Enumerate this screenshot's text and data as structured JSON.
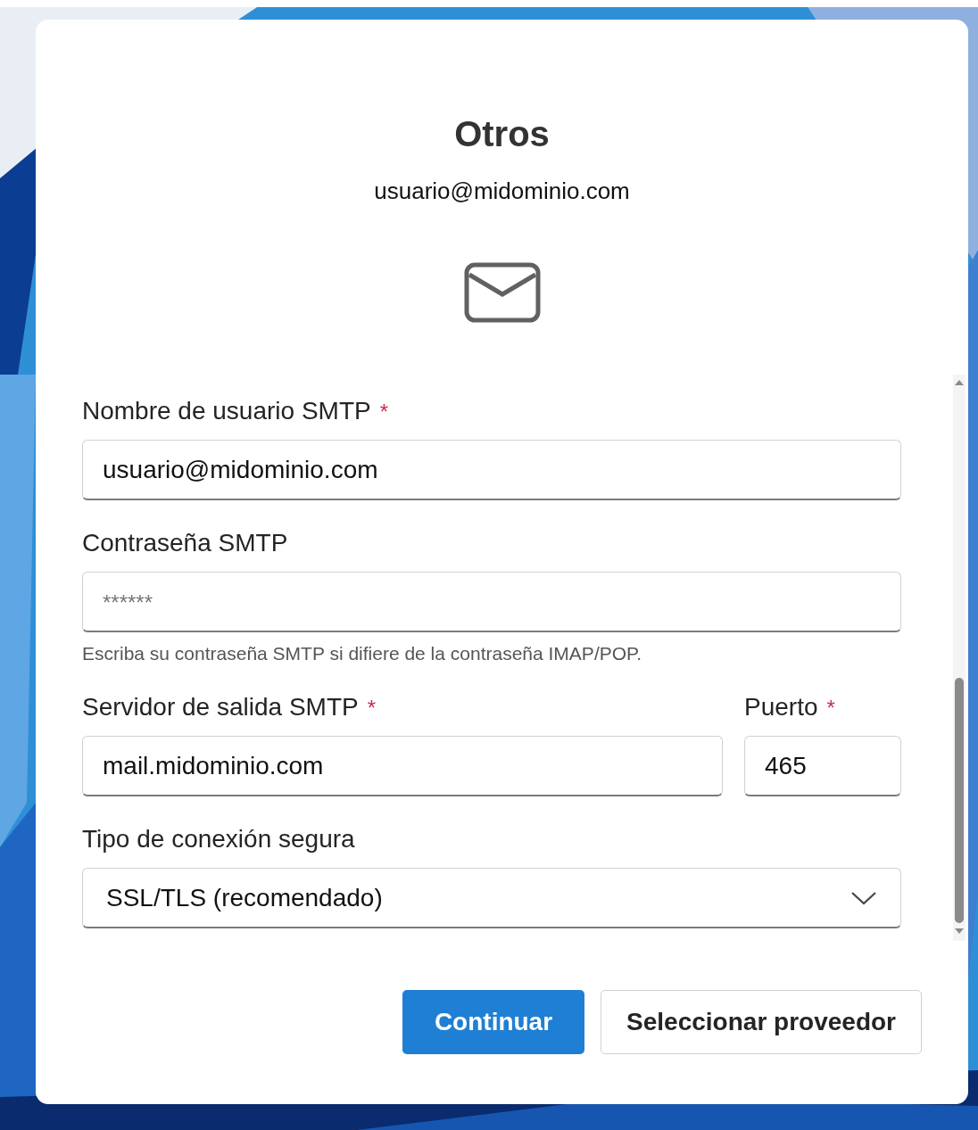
{
  "dialog": {
    "title": "Otros",
    "account": "usuario@midominio.com"
  },
  "form": {
    "rows": [
      {
        "fields": [
          {
            "kind": "text",
            "label": "Nombre de usuario SMTP",
            "required_mark": "*",
            "value": "usuario@midominio.com"
          }
        ]
      },
      {
        "fields": [
          {
            "kind": "password",
            "label": "Contraseña SMTP",
            "placeholder": "******",
            "hint": "Escriba su contraseña SMTP si difiere de la contraseña IMAP/POP."
          }
        ]
      },
      {
        "fields": [
          {
            "kind": "text",
            "label": "Servidor de salida SMTP",
            "required_mark": "*",
            "value": "mail.midominio.com"
          },
          {
            "kind": "number",
            "label": "Puerto",
            "required_mark": "*",
            "value": "465"
          }
        ]
      },
      {
        "fields": [
          {
            "kind": "select",
            "label": "Tipo de conexión segura",
            "value": "SSL/TLS (recomendado)"
          }
        ]
      }
    ]
  },
  "buttons": [
    {
      "label": "Continuar",
      "kind": "primary"
    },
    {
      "label": "Seleccionar proveedor",
      "kind": "secondary"
    }
  ]
}
